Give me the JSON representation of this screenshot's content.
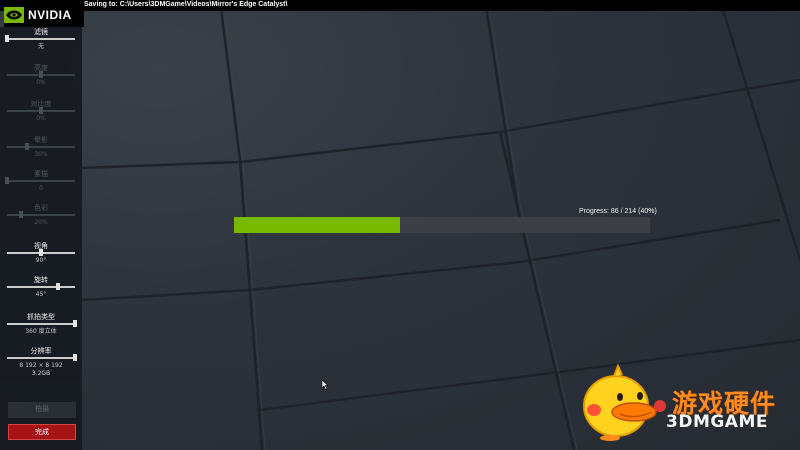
{
  "app": {
    "brand_name": "NVIDIA",
    "save_path": "Saving to: C:\\Users\\3DMGame\\Videos\\Mirror's Edge  Catalyst\\"
  },
  "panel": {
    "controls": [
      {
        "id": "filter",
        "label": "滤镜",
        "value": "无",
        "level": 0.0,
        "enabled": true
      },
      {
        "id": "brightness",
        "label": "亮度",
        "value": "0%",
        "level": 0.5,
        "enabled": false
      },
      {
        "id": "contrast",
        "label": "对比度",
        "value": "0%",
        "level": 0.5,
        "enabled": false
      },
      {
        "id": "vignette",
        "label": "晕影",
        "value": "30%",
        "level": 0.3,
        "enabled": false
      },
      {
        "id": "sharpen",
        "label": "素描",
        "value": "0",
        "level": 0.0,
        "enabled": false
      },
      {
        "id": "color",
        "label": "色彩",
        "value": "20%",
        "level": 0.2,
        "enabled": false
      },
      {
        "id": "fov",
        "label": "视角",
        "value": "90°",
        "level": 0.5,
        "enabled": true
      },
      {
        "id": "rotation",
        "label": "旋转",
        "value": "45°",
        "level": 0.75,
        "enabled": true
      },
      {
        "id": "capture",
        "label": "抓拍类型",
        "value": "360 度立体",
        "level": 1.0,
        "enabled": true
      },
      {
        "id": "resolution",
        "label": "分辨率",
        "value": "8 192 × 8 192",
        "value2": "3.2GB",
        "level": 1.0,
        "enabled": true
      }
    ],
    "share_label": "拍摄",
    "done_label": "完成"
  },
  "progress": {
    "text": "Progress: 86 / 214 (40%)",
    "fraction": 0.4,
    "fill_color": "#76b900"
  },
  "watermark": {
    "cn": "游戏硬件",
    "en": "3DMGAME"
  },
  "colors": {
    "accent_green": "#76b900",
    "done_red": "#a51317"
  },
  "icons": {
    "brand": "nvidia-eye-icon",
    "cursor": "mouse-cursor-icon",
    "mascot": "duck-mascot-icon"
  }
}
